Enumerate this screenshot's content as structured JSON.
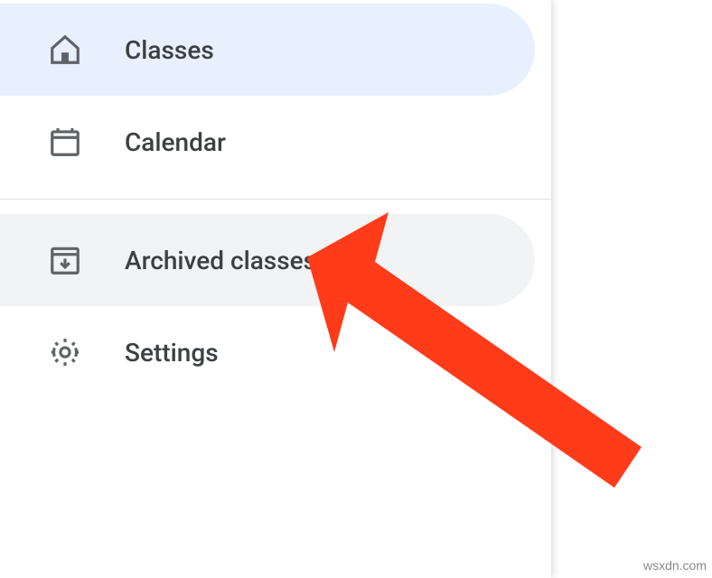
{
  "sidebar": {
    "items": [
      {
        "label": "Classes"
      },
      {
        "label": "Calendar"
      },
      {
        "label": "Archived classes"
      },
      {
        "label": "Settings"
      }
    ]
  },
  "watermark": "wsxdn.com"
}
